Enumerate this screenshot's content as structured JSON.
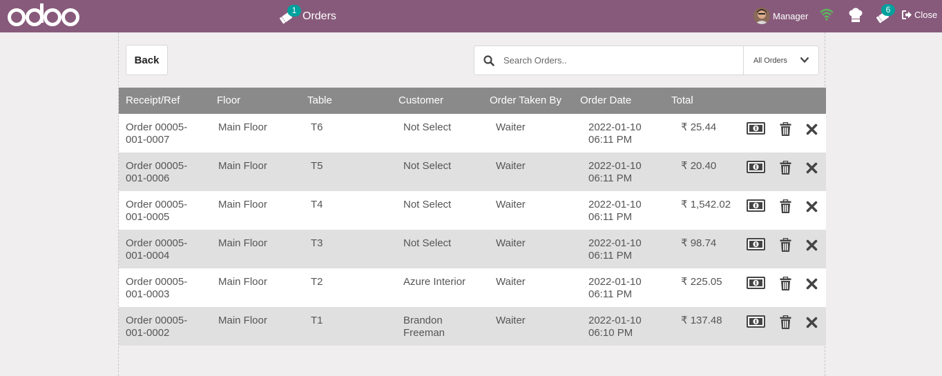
{
  "header": {
    "brand": "odoo",
    "orders_tab": {
      "label": "Orders",
      "badge": "1",
      "icon": "ticket-icon"
    },
    "user": {
      "name": "Manager"
    },
    "tickets_badge": "6",
    "close_label": "Close"
  },
  "toolbar": {
    "back_label": "Back",
    "search_placeholder": "Search Orders..",
    "filter_label": "All Orders"
  },
  "table": {
    "columns": [
      "Receipt/Ref",
      "Floor",
      "Table",
      "Customer",
      "Order Taken By",
      "Order Date",
      "Total"
    ],
    "rows": [
      {
        "ref": "Order 00005-001-0007",
        "floor": "Main Floor",
        "table": "T6",
        "customer": "Not Select",
        "taken_by": "Waiter",
        "date": "2022-01-10 06:11 PM",
        "total": "₹ 25.44"
      },
      {
        "ref": "Order 00005-001-0006",
        "floor": "Main Floor",
        "table": "T5",
        "customer": "Not Select",
        "taken_by": "Waiter",
        "date": "2022-01-10 06:11 PM",
        "total": "₹ 20.40"
      },
      {
        "ref": "Order 00005-001-0005",
        "floor": "Main Floor",
        "table": "T4",
        "customer": "Not Select",
        "taken_by": "Waiter",
        "date": "2022-01-10 06:11 PM",
        "total": "₹ 1,542.02"
      },
      {
        "ref": "Order 00005-001-0004",
        "floor": "Main Floor",
        "table": "T3",
        "customer": "Not Select",
        "taken_by": "Waiter",
        "date": "2022-01-10 06:11 PM",
        "total": "₹ 98.74"
      },
      {
        "ref": "Order 00005-001-0003",
        "floor": "Main Floor",
        "table": "T2",
        "customer": "Azure Interior",
        "taken_by": "Waiter",
        "date": "2022-01-10 06:11 PM",
        "total": "₹ 225.05"
      },
      {
        "ref": "Order 00005-001-0002",
        "floor": "Main Floor",
        "table": "T1",
        "customer": "Brandon Freeman",
        "taken_by": "Waiter",
        "date": "2022-01-10 06:10 PM",
        "total": "₹ 137.48"
      }
    ]
  },
  "colors": {
    "brand": "#875a7b",
    "badge": "#00a09d",
    "wifi": "#5cb85c",
    "header_row": "#8a8a8a"
  }
}
